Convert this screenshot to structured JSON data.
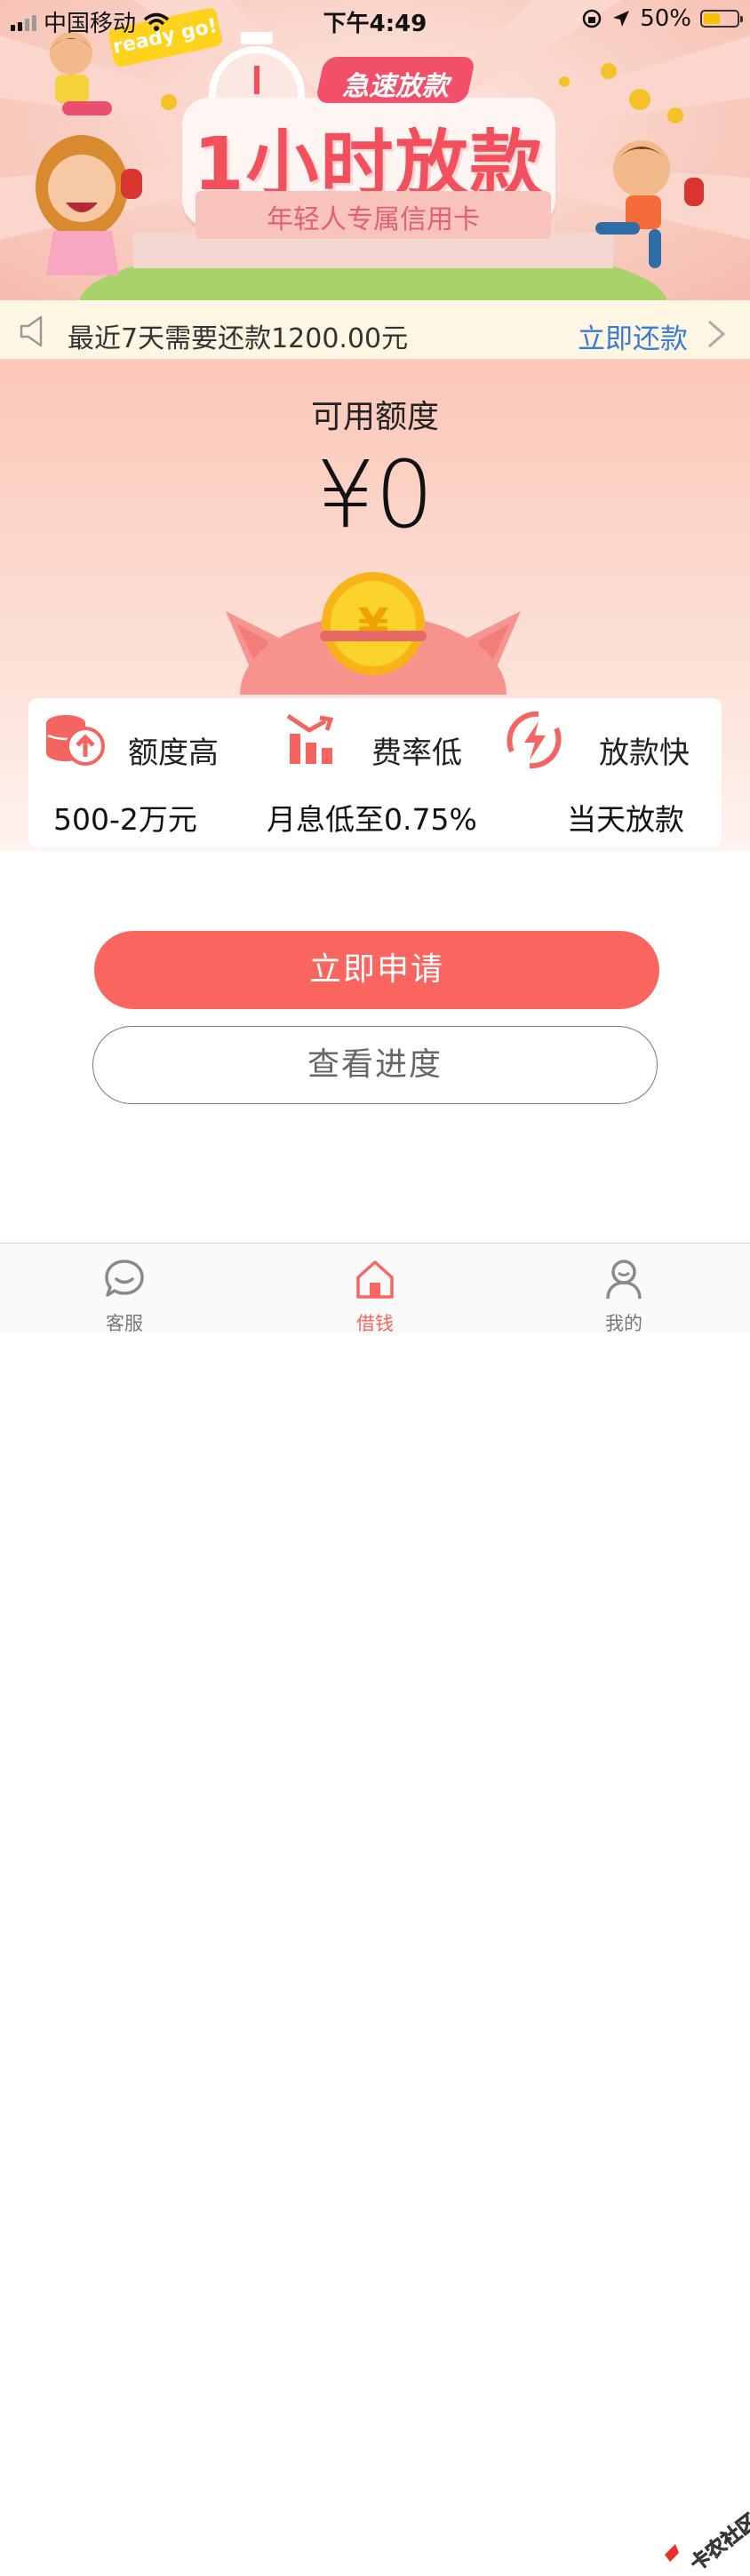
{
  "status_bar": {
    "carrier": "中国移动",
    "time": "下午4:49",
    "battery_percent": "50%",
    "battery_level": 0.5,
    "icons": [
      "signal-icon",
      "wifi-icon",
      "orientation-lock-icon",
      "location-icon",
      "battery-icon"
    ]
  },
  "banner": {
    "bubble": "ready go!",
    "tag": "急速放款",
    "title": "1小时放款",
    "subtitle": "年轻人专属信用卡"
  },
  "notice": {
    "text": "最近7天需要还款1200.00元",
    "action": "立即还款"
  },
  "quota": {
    "label": "可用额度",
    "value": "¥0"
  },
  "features": [
    {
      "title": "额度高",
      "desc": "500-2万元",
      "icon": "coins-up-icon"
    },
    {
      "title": "费率低",
      "desc": "月息低至0.75%",
      "icon": "bar-down-icon"
    },
    {
      "title": "放款快",
      "desc": "当天放款",
      "icon": "lightning-icon"
    }
  ],
  "actions": {
    "apply": "立即申请",
    "progress": "查看进度"
  },
  "tabbar": {
    "items": [
      {
        "label": "客服",
        "icon": "chat-icon"
      },
      {
        "label": "借钱",
        "icon": "home-icon"
      },
      {
        "label": "我的",
        "icon": "user-icon"
      }
    ],
    "active_index": 1
  },
  "watermark": "卡农社区",
  "colors": {
    "primary": "#fb6560",
    "link": "#3a7bd5",
    "notice_bg": "#fdf6e2"
  }
}
